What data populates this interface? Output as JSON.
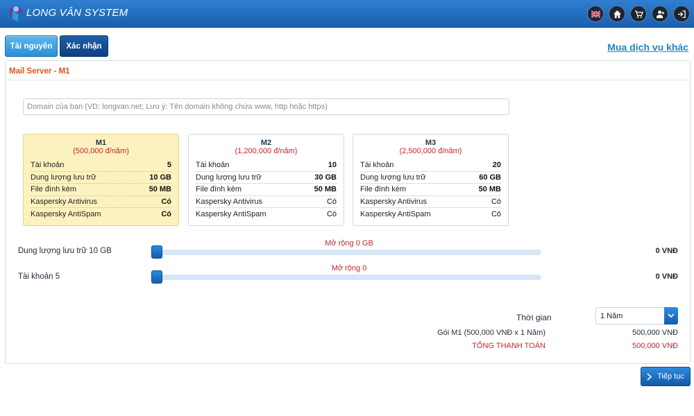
{
  "header": {
    "brand": "LONG VÂN SYSTEM",
    "icons": [
      "uk-flag-icon",
      "home-icon",
      "cart-icon",
      "user-add-icon",
      "sign-in-icon"
    ]
  },
  "tabs": [
    {
      "label": "Tài nguyên",
      "active": true
    },
    {
      "label": "Xác nhận",
      "active": false
    }
  ],
  "more_services_link": "Mua dịch vụ khác",
  "panel": {
    "title": "Mail Server - M1",
    "domain_placeholder": "Domain của bạn (VD: longvan.net; Lưu ý: Tên domain không chứa www, http hoặc https)"
  },
  "plans": [
    {
      "name": "M1",
      "price": "(500,000 đ/năm)",
      "selected": true,
      "rows": [
        {
          "label": "Tài khoản",
          "value": "5"
        },
        {
          "label": "Dung lượng lưu trữ",
          "value": "10 GB"
        },
        {
          "label": "File đính kèm",
          "value": "50 MB"
        },
        {
          "label": "Kaspersky Antivirus",
          "value": "Có"
        },
        {
          "label": "Kaspersky AntiSpam",
          "value": "Có"
        }
      ]
    },
    {
      "name": "M2",
      "price": "(1,200,000 đ/năm)",
      "selected": false,
      "rows": [
        {
          "label": "Tài khoản",
          "value": "10"
        },
        {
          "label": "Dung lượng lưu trữ",
          "value": "30 GB"
        },
        {
          "label": "File đính kèm",
          "value": "50 MB"
        },
        {
          "label": "Kaspersky Antivirus",
          "value": "Có"
        },
        {
          "label": "Kaspersky AntiSpam",
          "value": "Có"
        }
      ]
    },
    {
      "name": "M3",
      "price": "(2,500,000 đ/năm)",
      "selected": false,
      "rows": [
        {
          "label": "Tài khoản",
          "value": "20"
        },
        {
          "label": "Dung lượng lưu trữ",
          "value": "60 GB"
        },
        {
          "label": "File đính kèm",
          "value": "50 MB"
        },
        {
          "label": "Kaspersky Antivirus",
          "value": "Có"
        },
        {
          "label": "Kaspersky AntiSpam",
          "value": "Có"
        }
      ]
    }
  ],
  "sliders": [
    {
      "label": "Dung lượng lưu trữ 10 GB",
      "extension": "Mở rộng 0 GB",
      "price": "0 VNĐ",
      "fill_fraction": 0
    },
    {
      "label": "Tài khoản 5",
      "extension": "Mở rộng 0",
      "price": "0 VNĐ",
      "fill_fraction": 0
    }
  ],
  "time": {
    "label": "Thời gian",
    "selected": "1 Năm"
  },
  "summary": {
    "package_label": "Gói M1 (500,000 VNĐ x 1 Năm)",
    "package_value": "500,000 VNĐ",
    "total_label": "TỔNG THANH TOÁN",
    "total_value": "500,000 VNĐ"
  },
  "next_button": "Tiếp tục",
  "colors": {
    "primary": "#1a5fae",
    "accent_red": "#c4242f",
    "title_orange": "#e0541b",
    "selected_plan": "#fcf2c0"
  }
}
